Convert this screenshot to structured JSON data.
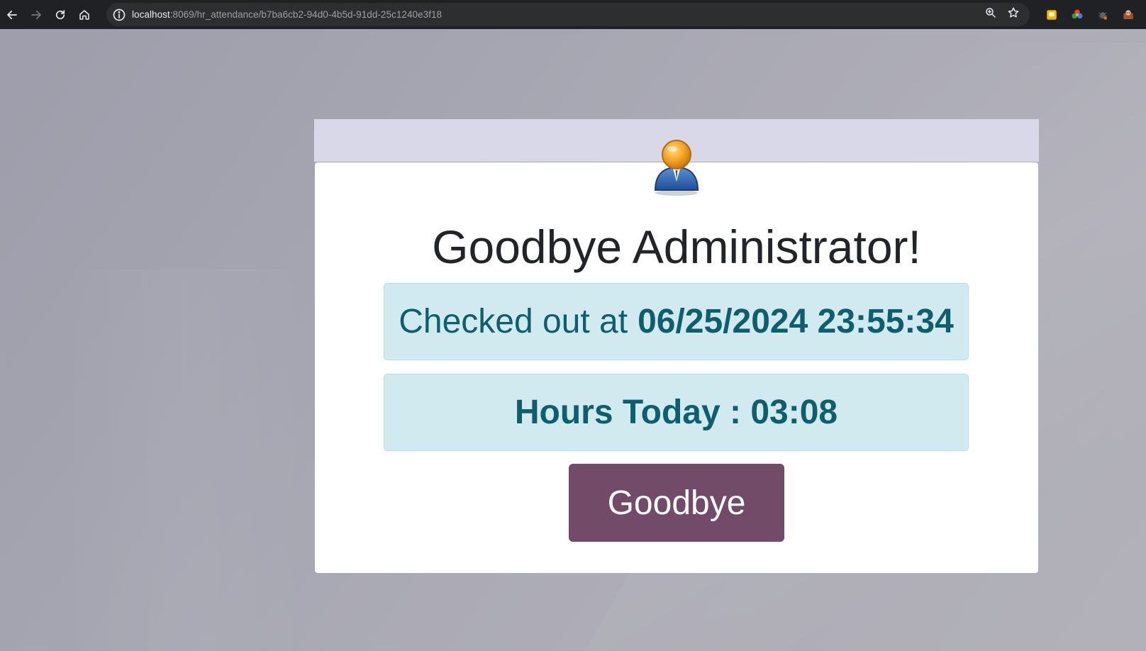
{
  "browser": {
    "url_host": "localhost",
    "url_rest": ":8069/hr_attendance/b7ba6cb2-94d0-4b5d-91dd-25c1240e3f18",
    "icons": {
      "back": "arrow-left-icon",
      "forward": "arrow-right-icon",
      "reload": "reload-icon",
      "home": "home-icon",
      "site_info": "info-circle-icon",
      "zoom": "zoom-icon",
      "bookmark": "star-icon"
    },
    "extensions": [
      "yellow-note-extension-icon",
      "color-wheel-extension-icon",
      "bug-extension-icon",
      "monkey-extension-icon"
    ]
  },
  "kiosk": {
    "greeting": "Goodbye Administrator!",
    "checked_out_prefix": "Checked out at",
    "checked_out_time": "06/25/2024 23:55:34",
    "hours_today": "Hours Today : 03:08",
    "goodbye_button": "Goodbye",
    "avatar_icon": "user-avatar-icon"
  },
  "colors": {
    "brand": "#714b67",
    "info_bg": "#d1eaf0",
    "info_text": "#0e5f6d",
    "header_band": "#d9d8e8"
  }
}
